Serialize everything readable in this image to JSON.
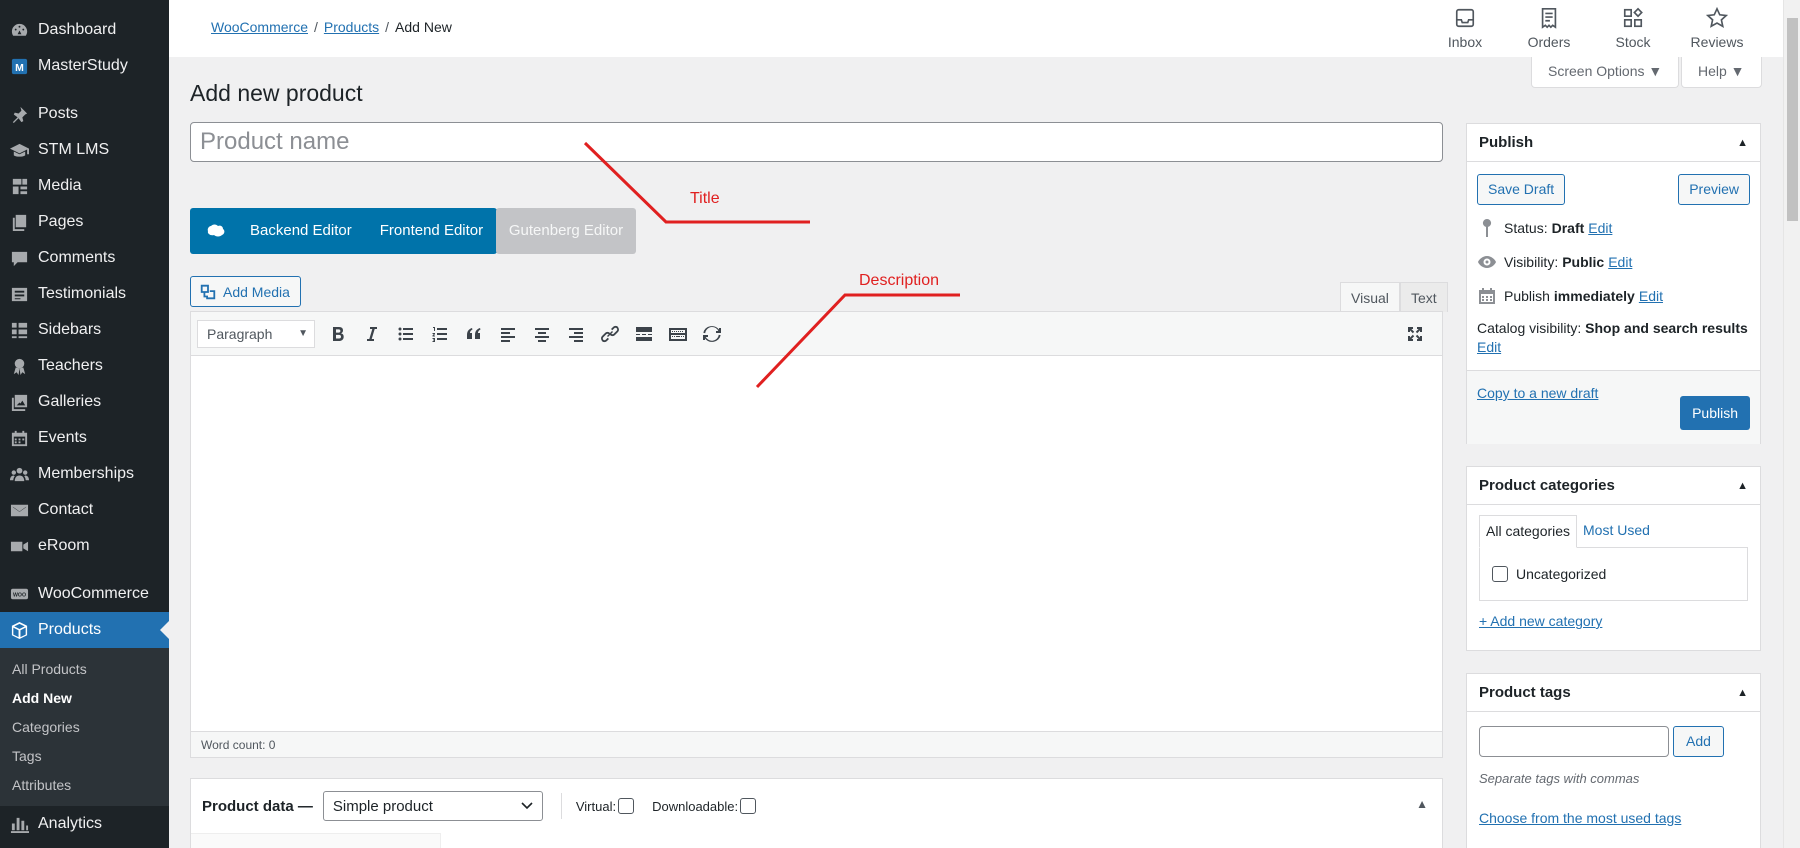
{
  "sidebar": {
    "items": [
      {
        "label": "Dashboard",
        "icon": "dashboard-icon"
      },
      {
        "label": "MasterStudy",
        "icon": "masterstudy-icon"
      },
      {
        "label": "Posts",
        "icon": "pin-icon"
      },
      {
        "label": "STM LMS",
        "icon": "graduation-icon"
      },
      {
        "label": "Media",
        "icon": "media-icon"
      },
      {
        "label": "Pages",
        "icon": "pages-icon"
      },
      {
        "label": "Comments",
        "icon": "comment-icon"
      },
      {
        "label": "Testimonials",
        "icon": "testimonial-icon"
      },
      {
        "label": "Sidebars",
        "icon": "grid-icon"
      },
      {
        "label": "Teachers",
        "icon": "award-icon"
      },
      {
        "label": "Galleries",
        "icon": "gallery-icon"
      },
      {
        "label": "Events",
        "icon": "calendar-icon"
      },
      {
        "label": "Memberships",
        "icon": "groups-icon"
      },
      {
        "label": "Contact",
        "icon": "mail-icon"
      },
      {
        "label": "eRoom",
        "icon": "video-icon"
      },
      {
        "label": "WooCommerce",
        "icon": "woo-icon"
      },
      {
        "label": "Products",
        "icon": "box-icon"
      },
      {
        "label": "Analytics",
        "icon": "bar-chart-icon"
      }
    ],
    "submenu": [
      "All Products",
      "Add New",
      "Categories",
      "Tags",
      "Attributes"
    ]
  },
  "breadcrumb": {
    "woo": "WooCommerce",
    "products": "Products",
    "current": "Add New",
    "sep": "/"
  },
  "topnav": [
    {
      "label": "Inbox",
      "icon": "inbox-icon"
    },
    {
      "label": "Orders",
      "icon": "orders-icon"
    },
    {
      "label": "Stock",
      "icon": "stock-icon"
    },
    {
      "label": "Reviews",
      "icon": "star-icon"
    }
  ],
  "screen_options": "Screen Options ▼",
  "help": "Help ▼",
  "page_title": "Add new product",
  "title_placeholder": "Product name",
  "editor_switch": {
    "backend": "Backend Editor",
    "frontend": "Frontend Editor",
    "gutenberg": "Gutenberg Editor"
  },
  "add_media": "Add Media",
  "editor_tabs": {
    "visual": "Visual",
    "text": "Text"
  },
  "format_select": "Paragraph",
  "toolbar_buttons": [
    "bold",
    "italic",
    "bulleted-list",
    "numbered-list",
    "blockquote",
    "align-left",
    "align-center",
    "align-right",
    "link",
    "read-more",
    "toolbar-toggle",
    "undo-redo"
  ],
  "word_count": "Word count: 0",
  "product_data": {
    "title": "Product data —",
    "type": "Simple product",
    "virtual": "Virtual:",
    "downloadable": "Downloadable:"
  },
  "publish": {
    "title": "Publish",
    "save_draft": "Save Draft",
    "preview": "Preview",
    "status_label": "Status:",
    "status_value": "Draft",
    "visibility_label": "Visibility:",
    "visibility_value": "Public",
    "publish_label": "Publish",
    "publish_value": "immediately",
    "edit": "Edit",
    "catalog_label": "Catalog visibility:",
    "catalog_value": "Shop and search results",
    "copy_draft": "Copy to a new draft",
    "publish_btn": "Publish"
  },
  "categories": {
    "title": "Product categories",
    "tab_all": "All categories",
    "tab_most": "Most Used",
    "item": "Uncategorized",
    "add_new": "+ Add new category"
  },
  "tags": {
    "title": "Product tags",
    "add": "Add",
    "hint": "Separate tags with commas",
    "choose": "Choose from the most used tags"
  },
  "annotations": {
    "title": "Title",
    "description": "Description",
    "color": "#e02020"
  },
  "colors": {
    "admin_dark": "#1d2327",
    "accent": "#2271b1",
    "vc_blue": "#0073aa"
  }
}
